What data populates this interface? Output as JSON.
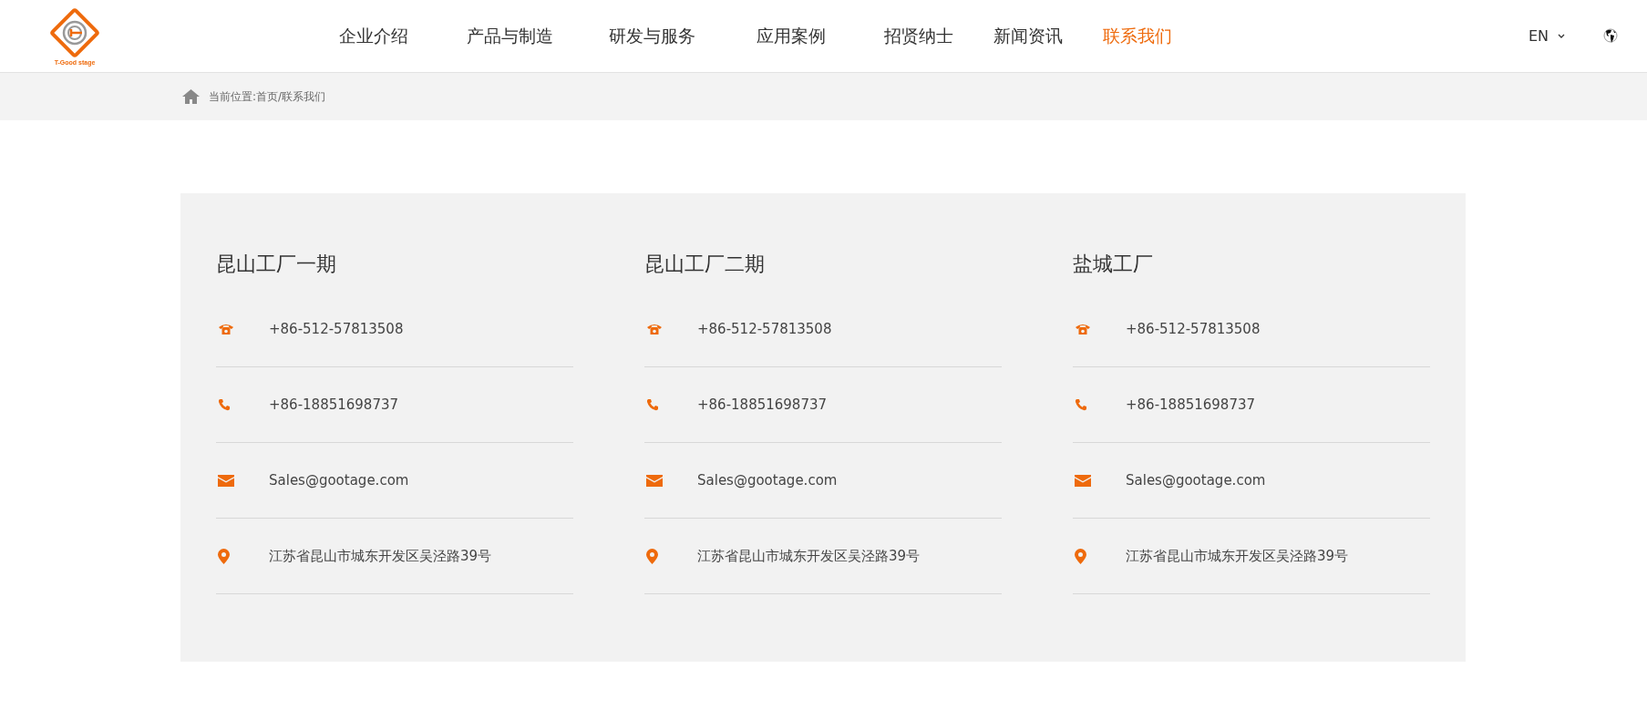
{
  "header": {
    "logo_text": "T-Good stage",
    "nav": [
      {
        "label": "企业介绍",
        "selected": false
      },
      {
        "label": "产品与制造",
        "selected": false
      },
      {
        "label": "研发与服务",
        "selected": false
      },
      {
        "label": "应用案例",
        "selected": false
      },
      {
        "label": "招贤纳士",
        "selected": false
      },
      {
        "label": "新闻资讯",
        "selected": false
      },
      {
        "label": "联系我们",
        "selected": true
      }
    ],
    "language": "EN"
  },
  "breadcrumb": "当前位置:首页/联系我们",
  "locations": [
    {
      "title": "昆山工厂一期",
      "contacts": [
        {
          "kind": "landline",
          "text": "+86-512-57813508"
        },
        {
          "kind": "mobile",
          "text": "+86-18851698737"
        },
        {
          "kind": "email",
          "text": "Sales@gootage.com"
        },
        {
          "kind": "address",
          "text": "江苏省昆山市城东开发区吴泾路39号"
        }
      ]
    },
    {
      "title": "昆山工厂二期",
      "contacts": [
        {
          "kind": "landline",
          "text": "+86-512-57813508"
        },
        {
          "kind": "mobile",
          "text": "+86-18851698737"
        },
        {
          "kind": "email",
          "text": "Sales@gootage.com"
        },
        {
          "kind": "address",
          "text": "江苏省昆山市城东开发区吴泾路39号"
        }
      ]
    },
    {
      "title": "盐城工厂",
      "contacts": [
        {
          "kind": "landline",
          "text": "+86-512-57813508"
        },
        {
          "kind": "mobile",
          "text": "+86-18851698737"
        },
        {
          "kind": "email",
          "text": "Sales@gootage.com"
        },
        {
          "kind": "address",
          "text": "江苏省昆山市城东开发区吴泾路39号"
        }
      ]
    }
  ]
}
